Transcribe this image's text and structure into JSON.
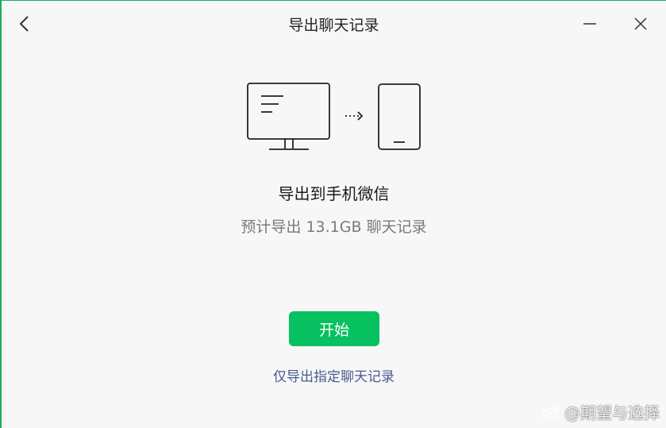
{
  "window": {
    "title": "导出聊天记录",
    "accent_color": "#07c160"
  },
  "titlebar": {
    "back_icon": "chevron-left-icon",
    "minimize_icon": "minimize-icon",
    "close_icon": "close-icon"
  },
  "illustration": {
    "source_icon": "monitor-icon",
    "arrow_icon": "dotted-arrow-right-icon",
    "target_icon": "phone-icon"
  },
  "main": {
    "heading": "导出到手机微信",
    "subtext": "预计导出 13.1GB 聊天记录",
    "start_button": "开始",
    "only_link": "仅导出指定聊天记录"
  },
  "watermark": {
    "icon": "weibo-icon",
    "text": "@期望与选择"
  }
}
